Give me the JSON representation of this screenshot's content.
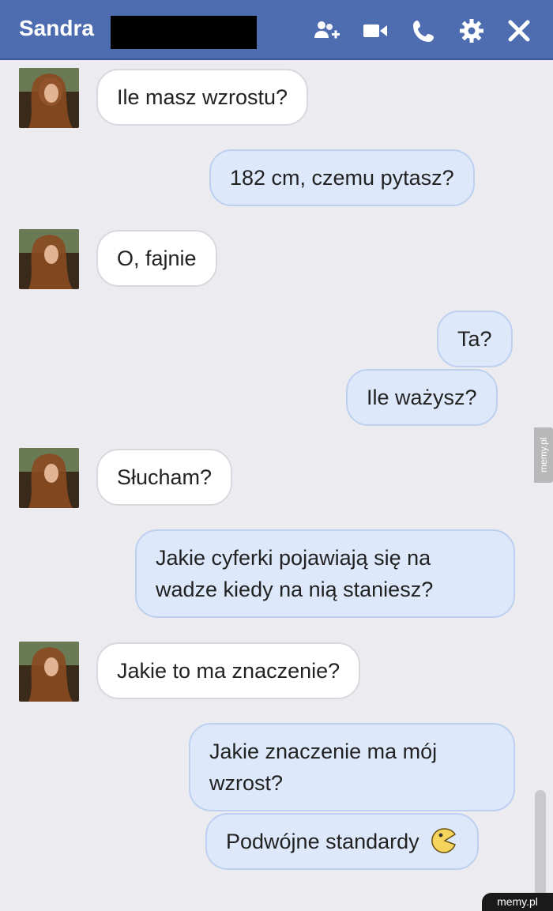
{
  "header": {
    "contact_name": "Sandra",
    "icons": [
      "add-people-icon",
      "video-camera-icon",
      "phone-icon",
      "gear-icon",
      "close-icon"
    ],
    "background": "#4e6db0"
  },
  "messages": [
    {
      "from": "them",
      "text": "Ile masz wzrostu?"
    },
    {
      "from": "me",
      "text": "182 cm, czemu pytasz?"
    },
    {
      "from": "them",
      "text": "O, fajnie"
    },
    {
      "from": "me",
      "text": "Ta?"
    },
    {
      "from": "me",
      "text": "Ile ważysz?"
    },
    {
      "from": "them",
      "text": "Słucham?"
    },
    {
      "from": "me",
      "line1": "Jakie cyferki pojawiają się na",
      "line2": "wadze kiedy na nią staniesz?"
    },
    {
      "from": "them",
      "text": "Jakie to ma znaczenie?"
    },
    {
      "from": "me",
      "line1": "Jakie znaczenie ma mój",
      "line2": "wzrost?"
    },
    {
      "from": "me",
      "text": "Podwójne standardy",
      "emoji": "pacman-emoticon-icon"
    }
  ],
  "colors": {
    "incoming_bubble": "#ffffff",
    "outgoing_bubble": "#dde8fb",
    "chat_background": "#ececf0"
  },
  "watermark": {
    "side": "memy.pl",
    "corner": "memy.pl"
  }
}
